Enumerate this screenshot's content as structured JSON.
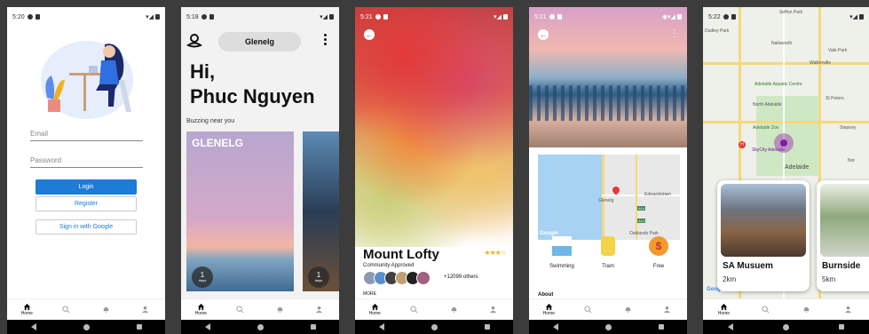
{
  "screens": {
    "login": {
      "status_time": "5:20",
      "email_placeholder": "Email",
      "password_placeholder": "Password",
      "login_label": "Login",
      "register_label": "Register",
      "google_label": "Sign in with Google"
    },
    "home": {
      "status_time": "5:18",
      "location": "Glenelg",
      "greeting_line1": "Hi,",
      "greeting_line2": "Phuc Nguyen",
      "section_label": "Buzzing near you",
      "card1_title": "GLENELG",
      "card1_days": "1",
      "card2_days": "1",
      "days_label": "days"
    },
    "detail": {
      "status_time": "5:21",
      "title": "Mount Lofty",
      "rating": 3,
      "subtitle": "Community Approved",
      "others": "+12099 others",
      "more": "MORE"
    },
    "amenities": {
      "status_time": "5:21",
      "map_labels": [
        "Edwardstown",
        "Glenelg",
        "Oaklands Park",
        "Google",
        "A14",
        "A13"
      ],
      "items": [
        {
          "label": "Swimming",
          "icon": "beach-icon"
        },
        {
          "label": "Tram",
          "icon": "tram-icon"
        },
        {
          "label": "Free",
          "icon": "dollar-icon"
        }
      ],
      "about_label": "About"
    },
    "map": {
      "status_time": "5:22",
      "map_labels": [
        "Sefton Park",
        "Dudley Park",
        "Nailsworth",
        "Vale Park",
        "Walkerville",
        "Adelaide Aquatic Centre",
        "North Adelaide",
        "St Peters",
        "Adelaide Zoo",
        "Stepney",
        "SkyCity Adelaide",
        "Adelaide",
        "Nor",
        "Google"
      ],
      "cards": [
        {
          "title": "SA Musuem",
          "distance": "2km"
        },
        {
          "title": "Burnside",
          "distance": "5km"
        }
      ]
    },
    "nav": {
      "home_label": "Home"
    }
  },
  "colors": {
    "primary": "#1e7bd6",
    "star": "#f2b01e",
    "background": "#3c3c3c"
  }
}
